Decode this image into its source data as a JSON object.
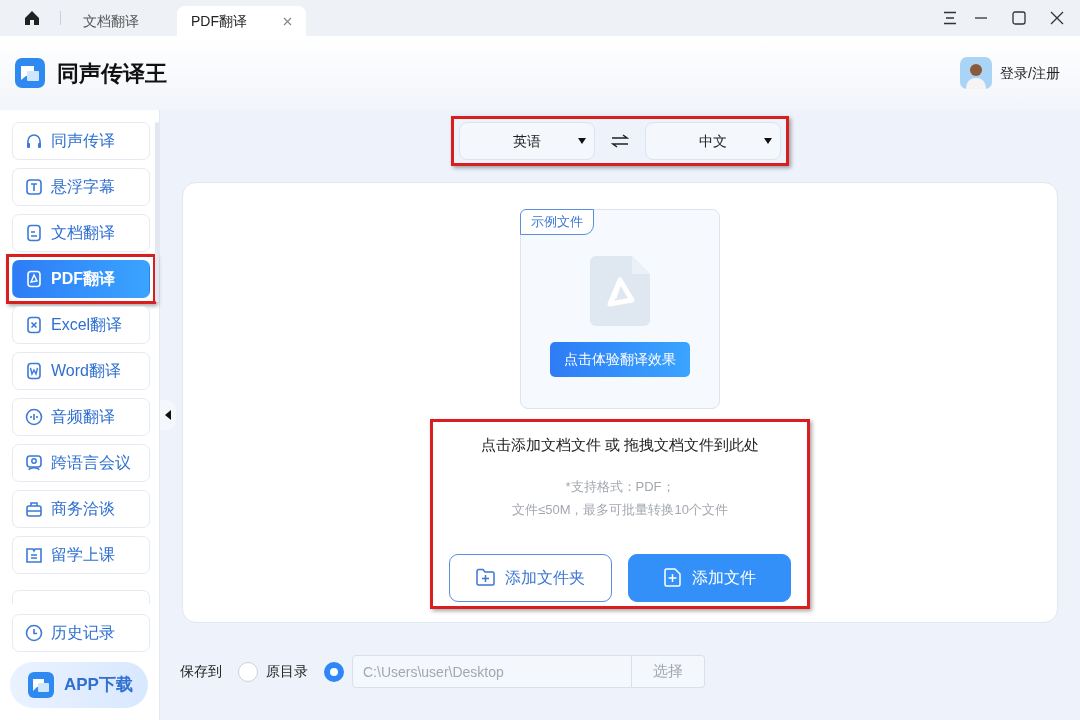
{
  "tabs": [
    {
      "label": "文档翻译",
      "selected": false,
      "closable": false
    },
    {
      "label": "PDF翻译",
      "selected": true,
      "closable": true
    }
  ],
  "app": {
    "title": "同声传译王",
    "login": "登录/注册"
  },
  "sidebar": {
    "items": [
      {
        "label": "同声传译",
        "selected": false,
        "highlighted": false
      },
      {
        "label": "悬浮字幕",
        "selected": false,
        "highlighted": false
      },
      {
        "label": "文档翻译",
        "selected": false,
        "highlighted": false
      },
      {
        "label": "PDF翻译",
        "selected": true,
        "highlighted": true
      },
      {
        "label": "Excel翻译",
        "selected": false,
        "highlighted": false
      },
      {
        "label": "Word翻译",
        "selected": false,
        "highlighted": false
      },
      {
        "label": "音频翻译",
        "selected": false,
        "highlighted": false
      },
      {
        "label": "跨语言会议",
        "selected": false,
        "highlighted": false
      },
      {
        "label": "商务洽谈",
        "selected": false,
        "highlighted": false
      },
      {
        "label": "留学上课",
        "selected": false,
        "highlighted": false
      }
    ],
    "history": "历史记录",
    "download": "APP下载"
  },
  "language_bar": {
    "source": "英语",
    "target": "中文",
    "highlighted": true
  },
  "sample": {
    "tag": "示例文件",
    "button": "点击体验翻译效果"
  },
  "drop_zone": {
    "prompt": "点击添加文档文件 或 拖拽文档文件到此处",
    "formats": "*支持格式：PDF；",
    "limits": "文件≤50M，最多可批量转换10个文件",
    "highlighted": true,
    "buttons": [
      {
        "label": "添加文件夹",
        "kind": "outline"
      },
      {
        "label": "添加文件",
        "kind": "primary"
      }
    ]
  },
  "save": {
    "label": "保存到",
    "options": [
      {
        "kind": "original",
        "label": "原目录",
        "selected": false
      },
      {
        "kind": "path",
        "value": "C:\\Users\\user\\Desktop",
        "button": "选择",
        "selected": true
      }
    ]
  }
}
